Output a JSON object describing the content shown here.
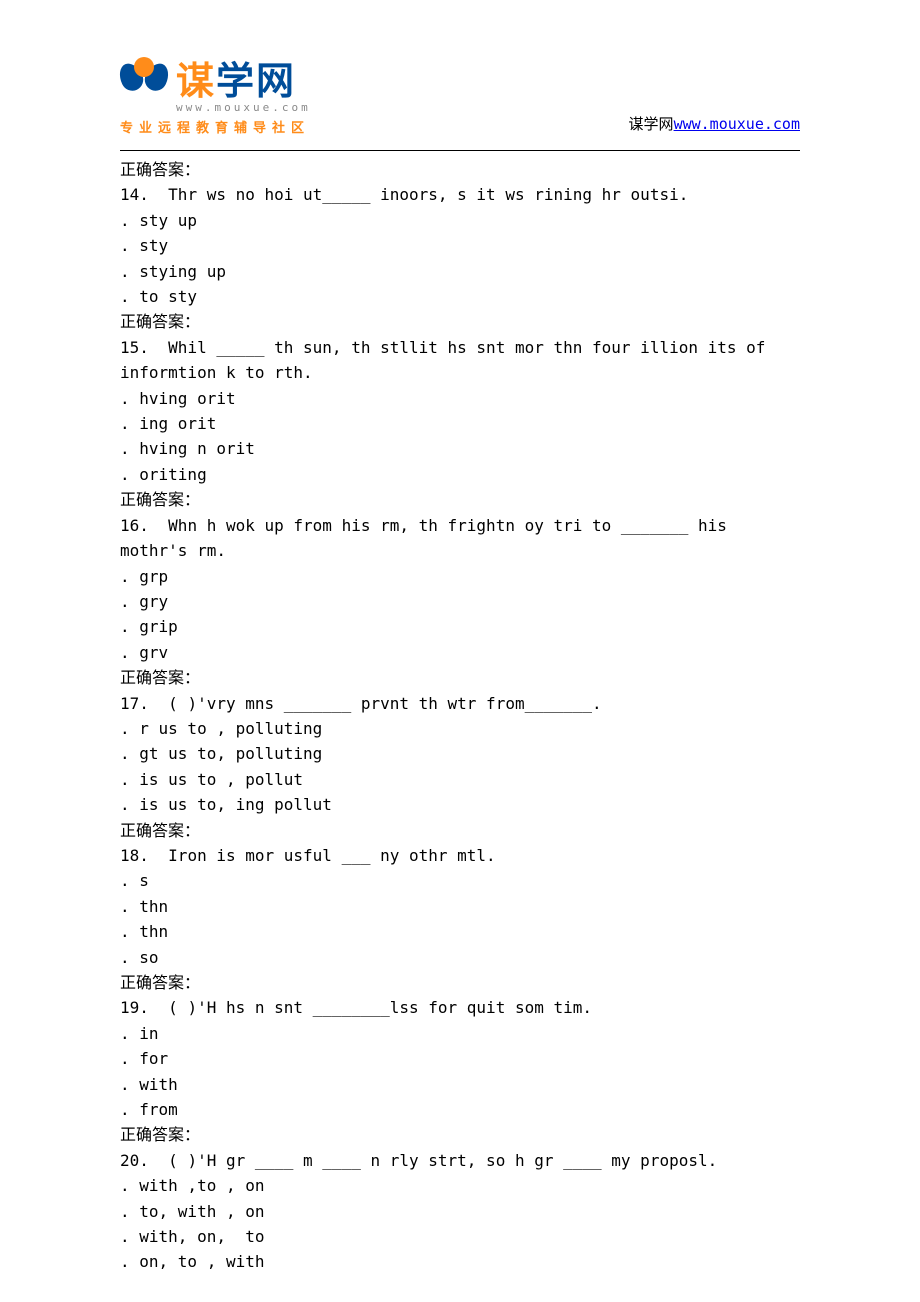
{
  "header": {
    "logo": {
      "char1": "谋",
      "char2": "学",
      "char3": "网",
      "domain": "www.mouxue.com",
      "tagline": "专业远程教育辅导社区"
    },
    "siteLink": {
      "prefix": "谋学网",
      "url": "www.mouxue.com"
    }
  },
  "answerLabel": "正确答案：",
  "questions": [
    {
      "num": "14.",
      "text": "  Thr ws no hoi ut_____ inoors, s it ws rining hr outsi.",
      "options": [
        ". sty up",
        ". sty",
        ". stying up",
        ". to sty"
      ]
    },
    {
      "num": "15.",
      "text": "  Whil _____ th sun, th stllit hs snt mor thn four illion its of informtion k to rth.",
      "options": [
        ". hving orit",
        ". ing orit",
        ". hving n orit",
        ". oriting"
      ]
    },
    {
      "num": "16.",
      "text": "  Whn h wok up from his rm, th frightn oy tri to _______ his mothr's rm.",
      "options": [
        ". grp",
        ". gry",
        ". grip",
        ". grv"
      ]
    },
    {
      "num": "17.",
      "text": "  ( )'vry mns _______ prvnt th wtr from_______.",
      "options": [
        ". r us to , polluting",
        ". gt us to, polluting",
        ". is us to , pollut",
        ". is us to, ing pollut"
      ]
    },
    {
      "num": "18.",
      "text": "  Iron is mor usful ___ ny othr mtl.",
      "options": [
        ". s",
        ". thn",
        ". thn",
        ". so"
      ]
    },
    {
      "num": "19.",
      "text": "  ( )'H hs n snt ________lss for quit som tim.",
      "options": [
        ". in",
        ". for",
        ". with",
        ". from"
      ]
    },
    {
      "num": "20.",
      "text": "  ( )'H gr ____ m ____ n rly strt, so h gr ____ my proposl.",
      "options": [
        ". with ,to , on",
        ". to, with , on",
        ". with, on,  to",
        ". on, to , with"
      ]
    }
  ]
}
